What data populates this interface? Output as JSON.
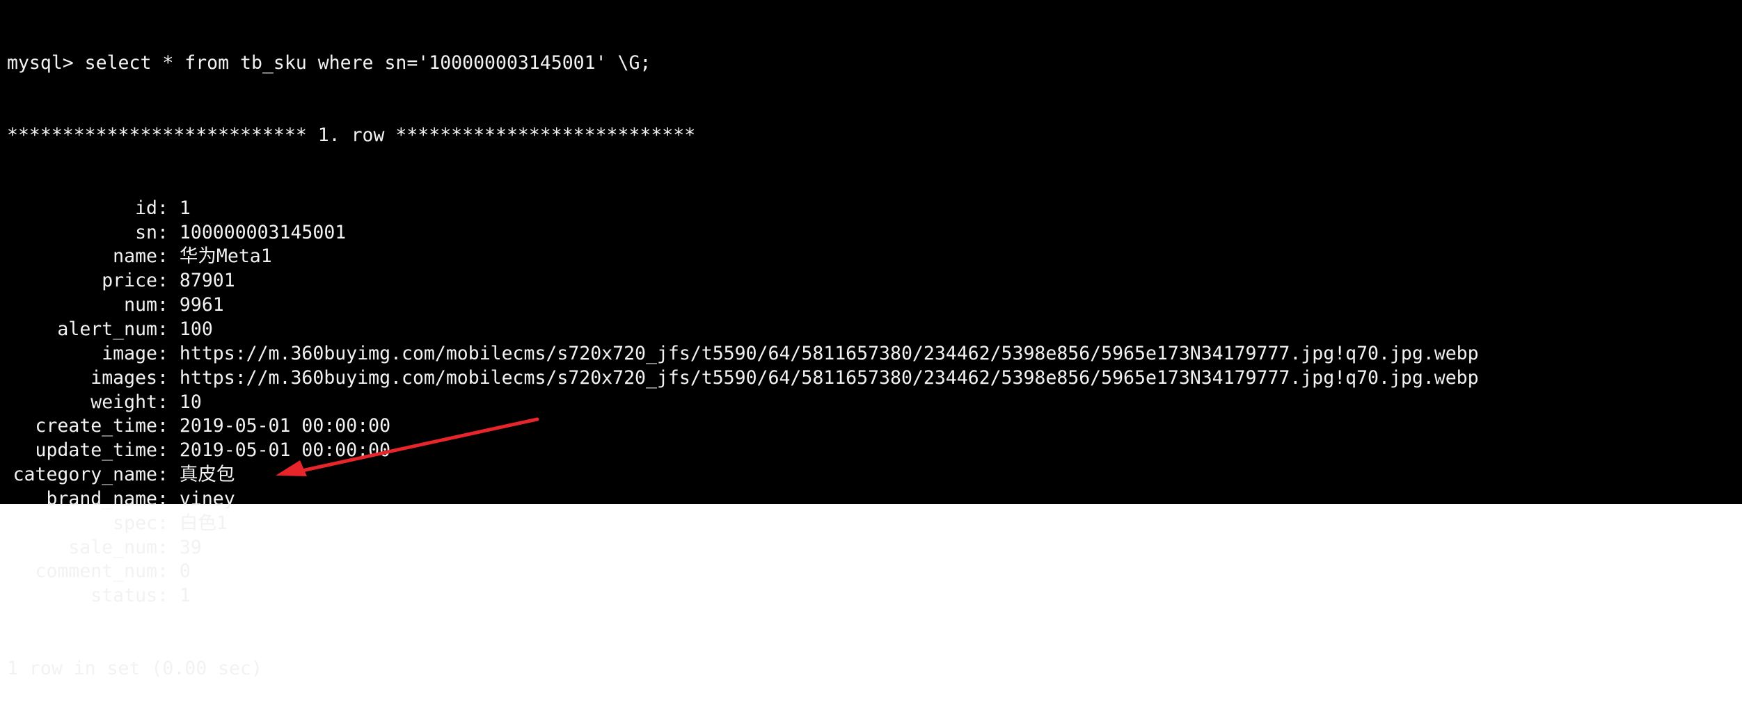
{
  "terminal": {
    "command_line": "mysql> select * from tb_sku where sn='100000003145001' \\G;",
    "row_header": "*************************** 1. row ***************************",
    "fields": [
      {
        "name": "id",
        "value": "1"
      },
      {
        "name": "sn",
        "value": "100000003145001"
      },
      {
        "name": "name",
        "value": "华为Meta1"
      },
      {
        "name": "price",
        "value": "87901"
      },
      {
        "name": "num",
        "value": "9961"
      },
      {
        "name": "alert_num",
        "value": "100"
      },
      {
        "name": "image",
        "value": "https://m.360buyimg.com/mobilecms/s720x720_jfs/t5590/64/5811657380/234462/5398e856/5965e173N34179777.jpg!q70.jpg.webp"
      },
      {
        "name": "images",
        "value": "https://m.360buyimg.com/mobilecms/s720x720_jfs/t5590/64/5811657380/234462/5398e856/5965e173N34179777.jpg!q70.jpg.webp"
      },
      {
        "name": "weight",
        "value": "10"
      },
      {
        "name": "create_time",
        "value": "2019-05-01 00:00:00"
      },
      {
        "name": "update_time",
        "value": "2019-05-01 00:00:00"
      },
      {
        "name": "category_name",
        "value": "真皮包"
      },
      {
        "name": "brand_name",
        "value": "viney"
      },
      {
        "name": "spec",
        "value": "白色1"
      },
      {
        "name": "sale_num",
        "value": "39"
      },
      {
        "name": "comment_num",
        "value": "0"
      },
      {
        "name": "status",
        "value": "1"
      }
    ],
    "result_summary": "1 row in set (0.00 sec)"
  },
  "colors": {
    "background": "#000000",
    "text": "#f2f2f2",
    "annotation_arrow": "#e8252a"
  }
}
